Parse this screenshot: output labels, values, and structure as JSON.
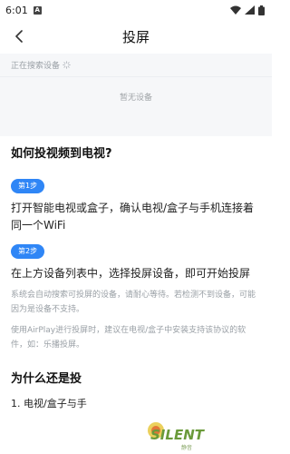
{
  "status_bar": {
    "time": "6:01",
    "alert_glyph": "A"
  },
  "header": {
    "title": "投屏",
    "back_icon": "chevron-left-icon"
  },
  "search": {
    "status_text": "正在搜索设备",
    "spinner_icon": "loading-spinner-icon",
    "empty_text": "暂无设备"
  },
  "guide": {
    "title": "如何投视频到电视?",
    "step1": {
      "badge": "第1步",
      "text": "打开智能电视或盒子，确认电视/盒子与手机连接着同一个WiFi"
    },
    "step2": {
      "badge": "第2步",
      "text": "在上方设备列表中，选择投屏设备，即可开始投屏"
    },
    "hint1": "系统会自动搜索可投屏的设备，请耐心等待。若检测不到设备，可能因为是设备不支持。",
    "hint2": "使用AirPlay进行投屏时，建议在电视/盒子中安装支持该协议的软件，如：乐播投屏。"
  },
  "why": {
    "title": "为什么还是投",
    "item1": "1. 电视/盒子与手"
  },
  "watermark": {
    "text": "SILENT",
    "subtext": "静音"
  },
  "colors": {
    "accent": "#2f86f6",
    "hint": "#9aa0a6",
    "section_bg": "#f6f7f9",
    "watermark": "#6a9a3a"
  }
}
